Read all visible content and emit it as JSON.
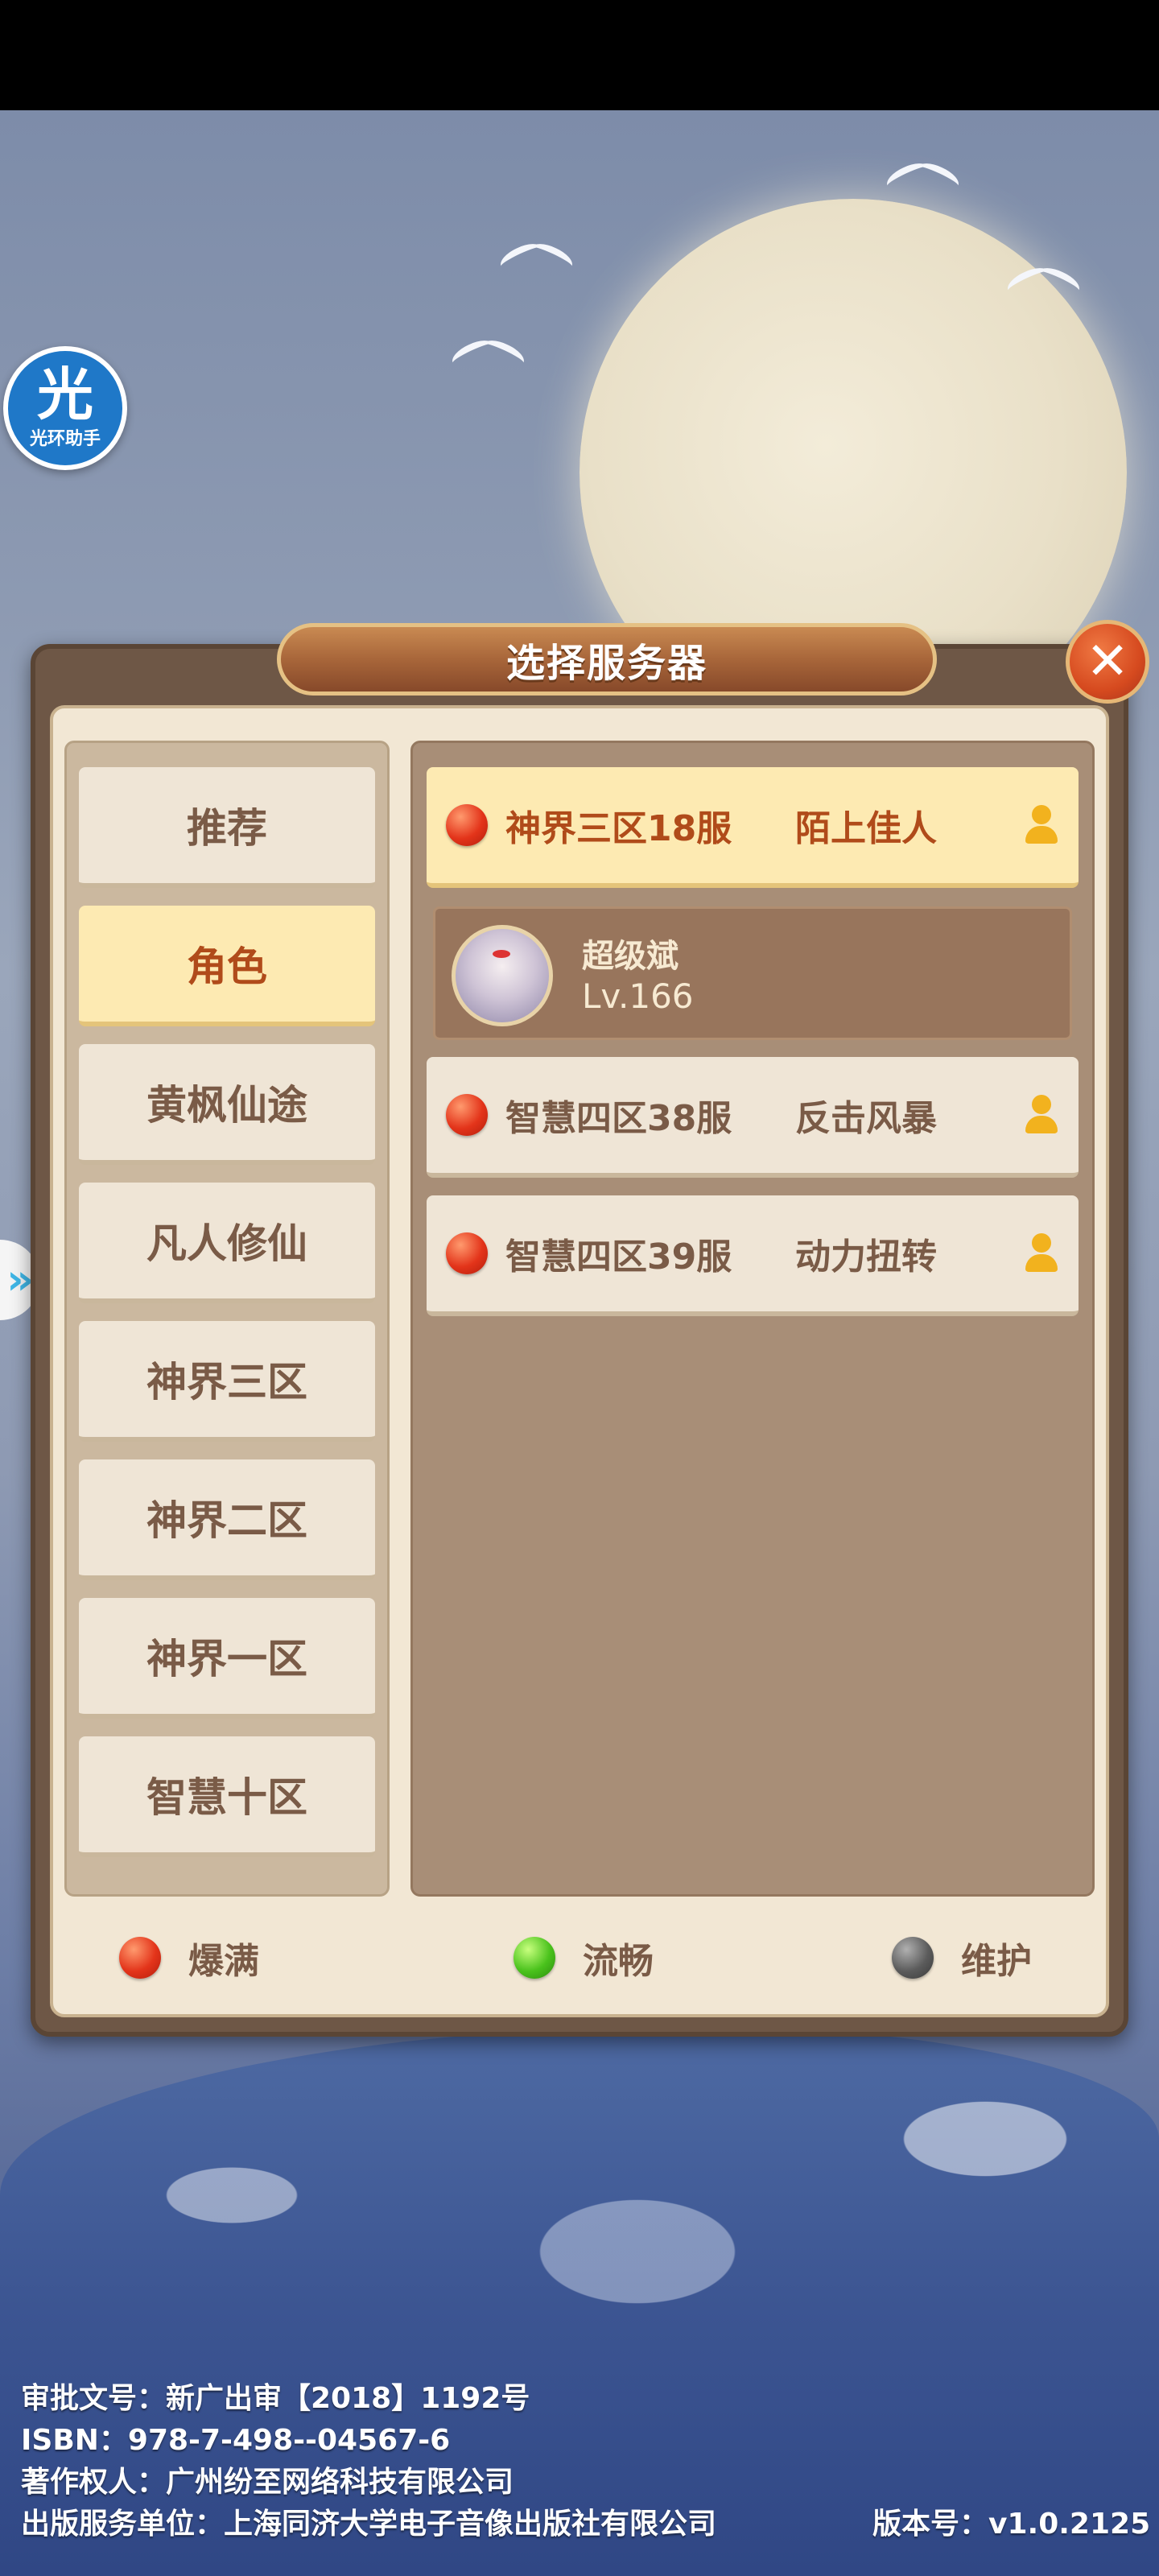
{
  "assistant": {
    "glyph": "光",
    "label": "光环助手"
  },
  "dialog": {
    "title": "选择服务器",
    "close_glyph": "✕"
  },
  "categories": [
    {
      "label": "推荐",
      "active": false
    },
    {
      "label": "角色",
      "active": true
    },
    {
      "label": "黄枫仙途",
      "active": false
    },
    {
      "label": "凡人修仙",
      "active": false
    },
    {
      "label": "神界三区",
      "active": false
    },
    {
      "label": "神界二区",
      "active": false
    },
    {
      "label": "神界一区",
      "active": false
    },
    {
      "label": "智慧十区",
      "active": false
    }
  ],
  "servers": [
    {
      "name": "神界三区18服",
      "role": "陌上佳人",
      "status": "full",
      "active": true
    },
    {
      "name": "智慧四区38服",
      "role": "反击风暴",
      "status": "full",
      "active": false
    },
    {
      "name": "智慧四区39服",
      "role": "动力扭转",
      "status": "full",
      "active": false
    }
  ],
  "character": {
    "name": "超级斌",
    "level": "Lv.166"
  },
  "legend": [
    {
      "label": "爆满",
      "color": "red"
    },
    {
      "label": "流畅",
      "color": "green"
    },
    {
      "label": "维护",
      "color": "gray"
    }
  ],
  "footer": {
    "approval": "审批文号：新广出审【2018】1192号",
    "isbn": "ISBN：978-7-498--04567-6",
    "copyright": "著作权人：广州纷至网络科技有限公司",
    "publisher": "出版服务单位：上海同济大学电子音像出版社有限公司",
    "version": "版本号：v1.0.2125"
  },
  "side_arrow_glyph": "»"
}
